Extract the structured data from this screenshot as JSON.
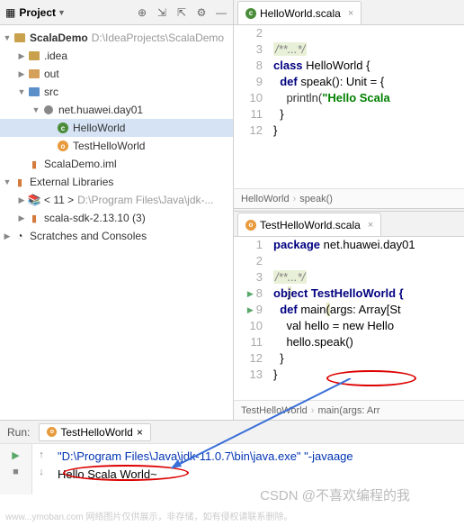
{
  "leftPanel": {
    "title": "Project",
    "tree": {
      "root": {
        "name": "ScalaDemo",
        "path": "D:\\IdeaProjects\\ScalaDemo"
      },
      "idea": ".idea",
      "out": "out",
      "src": "src",
      "pkg": "net.huawei.day01",
      "helloWorld": "HelloWorld",
      "testHello": "TestHelloWorld",
      "iml": "ScalaDemo.iml",
      "extLibs": "External Libraries",
      "jdk": "< 11 >",
      "jdkPath": "D:\\Program Files\\Java\\jdk-...",
      "sdk": "scala-sdk-2.13.10 (3)",
      "scratches": "Scratches and Consoles"
    }
  },
  "editors": {
    "top": {
      "tabName": "HelloWorld.scala",
      "lines": {
        "l2": "2",
        "l3": "3",
        "l8": "8",
        "l9": "9",
        "l10": "10",
        "l11": "11",
        "l12": "12"
      },
      "code": {
        "comment": "/**...*/",
        "classDecl1": "class ",
        "classDecl2": "HelloWorld {",
        "defDecl1": "  def ",
        "defDecl2": "speak(): Unit = {",
        "printlnPre": "    println(",
        "str": "\"Hello Scala",
        "brace1": "  }",
        "brace2": "}"
      },
      "breadcrumb": {
        "a": "HelloWorld",
        "b": "speak()"
      }
    },
    "bottom": {
      "tabName": "TestHelloWorld.scala",
      "lines": {
        "l1": "1",
        "l2": "2",
        "l3": "3",
        "l8": "8",
        "l9": "9",
        "l10": "10",
        "l11": "11",
        "l12": "12",
        "l13": "13"
      },
      "code": {
        "pkg1": "package ",
        "pkg2": "net.huawei.day01",
        "comment": "/**...*/",
        "obj1": "ob",
        "objHighlight": "j",
        "obj2": "ect TestHelloWorld {",
        "main1": "  def ",
        "mainName": "main",
        "mainParen": "(",
        "mainArgs": "args: Array[St",
        "valLine": "    val hello = new Hello",
        "speakCall": "    hello.speak()",
        "brace1": "  }",
        "brace2": "}"
      },
      "breadcrumb": {
        "a": "TestHelloWorld",
        "b": "main(args: Arr"
      }
    }
  },
  "runPanel": {
    "label": "Run:",
    "tabName": "TestHelloWorld",
    "console": {
      "cmd": "\"D:\\Program Files\\Java\\jdk-11.0.7\\bin\\java.exe\" \"-javaage",
      "out": "Hello Scala World~"
    }
  },
  "watermark": "CSDN @不喜欢编程的我",
  "footer": "www...ymoban.com 网络图片仅供展示，非存储，如有侵权请联系删除。"
}
